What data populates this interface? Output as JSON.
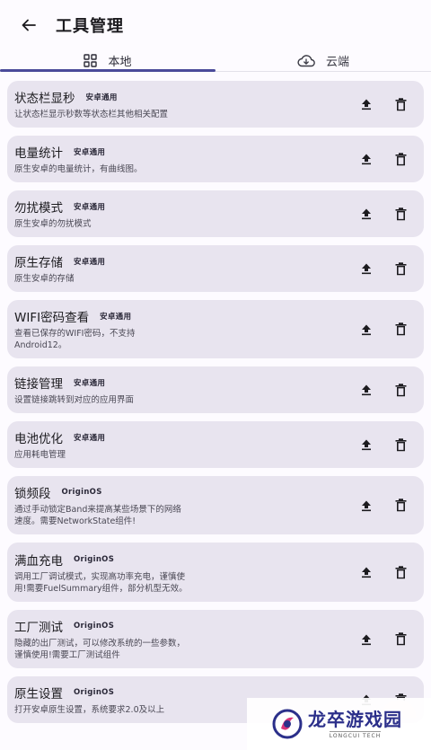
{
  "app_bar": {
    "title": "工具管理"
  },
  "tabs": [
    {
      "label": "本地",
      "icon": "grid-icon",
      "active": true
    },
    {
      "label": "云端",
      "icon": "cloud-download-icon",
      "active": false
    }
  ],
  "colors": {
    "card_bg": "#e8e4ef",
    "tab_indicator": "#4a4a9a",
    "page_bg": "#fdfbff"
  },
  "tools": [
    {
      "title": "状态栏显秒",
      "tag": "安卓通用",
      "desc": "让状态栏显示秒数等状态栏其他相关配置"
    },
    {
      "title": "电量统计",
      "tag": "安卓通用",
      "desc": "原生安卓的电量统计，有曲线图。"
    },
    {
      "title": "勿扰模式",
      "tag": "安卓通用",
      "desc": "原生安卓的勿扰模式"
    },
    {
      "title": "原生存储",
      "tag": "安卓通用",
      "desc": "原生安卓的存储"
    },
    {
      "title": "WIFI密码查看",
      "tag": "安卓通用",
      "desc": "查看已保存的WIFI密码，不支持Android12。"
    },
    {
      "title": "链接管理",
      "tag": "安卓通用",
      "desc": "设置链接跳转到对应的应用界面"
    },
    {
      "title": "电池优化",
      "tag": "安卓通用",
      "desc": "应用耗电管理"
    },
    {
      "title": "锁频段",
      "tag": "OriginOS",
      "desc": "通过手动锁定Band来提高某些场景下的网络速度。需要NetworkState组件!"
    },
    {
      "title": "满血充电",
      "tag": "OriginOS",
      "desc": "调用工厂调试模式，实现高功率充电，谨慎使用!需要FuelSummary组件，部分机型无效。"
    },
    {
      "title": "工厂测试",
      "tag": "OriginOS",
      "desc": "隐藏的出厂测试，可以修改系统的一些参数，谨慎使用!需要工厂测试组件"
    },
    {
      "title": "原生设置",
      "tag": "OriginOS",
      "desc": "打开安卓原生设置，系统要求2.0及以上"
    }
  ],
  "watermark": {
    "title": "龙卒游戏园",
    "subtitle": "LONGCUI TECH"
  }
}
